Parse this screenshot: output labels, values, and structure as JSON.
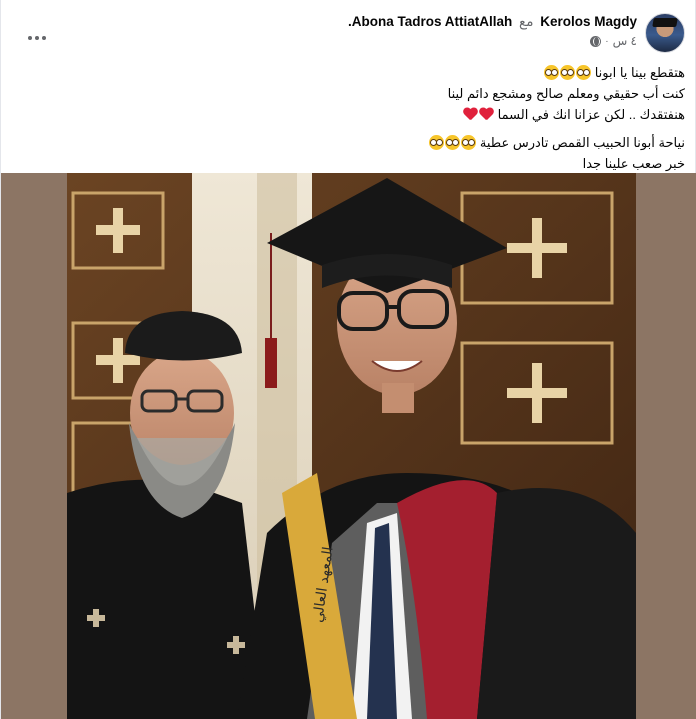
{
  "post": {
    "author": "Kerolos Magdy",
    "with_word": "مع",
    "tagged": "Abona Tadros AttiatAllah",
    "tagged_suffix": ".",
    "time": "٤ س",
    "separator": "·",
    "privacy_icon": "globe-icon",
    "more_icon": "more-options-icon"
  },
  "text": {
    "lines": [
      "هتقطع بينا يا ابونا",
      "كنت أب حقيقي ومعلم صالح ومشجع دائم لينا",
      "هنفتقدك .. لكن عزانا انك في السما",
      "نياحة أبونا الحبيب القمص تادرس عطية",
      "خبر صعب علينا جدا"
    ],
    "emoji_sad": "pleading-face",
    "emoji_heart": "red-heart"
  },
  "image": {
    "subject": "selfie-graduation-with-priest",
    "sash_text": "المعهد العالي"
  },
  "colors": {
    "text": "#050505",
    "secondary": "#65676b",
    "photo_bg": "#8c7564"
  }
}
